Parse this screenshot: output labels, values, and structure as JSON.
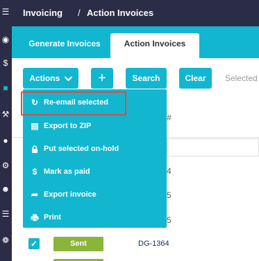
{
  "sidebar": {
    "icons": [
      "menu-icon",
      "globe-icon",
      "dollar-icon",
      "folder-icon",
      "wrench-icon",
      "bicycle-icon",
      "gear-icon",
      "user-icon",
      "list-icon",
      "cog-icon"
    ]
  },
  "header": {
    "breadcrumb": [
      "Invoicing",
      "Action Invoices"
    ],
    "separator": "/"
  },
  "tabs": [
    {
      "label": "Generate Invoices",
      "active": false
    },
    {
      "label": "Action Invoices",
      "active": true
    }
  ],
  "toolbar": {
    "actions_label": "Actions",
    "plus_label": "+",
    "search_label": "Search",
    "clear_label": "Clear",
    "selected_text": "Selected"
  },
  "actions_menu": {
    "items": [
      {
        "label": "Re-email selected",
        "icon": "refresh-icon",
        "highlighted": true
      },
      {
        "label": "Export to ZIP",
        "icon": "zip-file-icon"
      },
      {
        "label": "Put selected on-hold",
        "icon": "lock-icon"
      },
      {
        "label": "Mark as paid",
        "icon": "dollar-icon"
      },
      {
        "label": "Export invoice",
        "icon": "share-icon"
      },
      {
        "label": "Print",
        "icon": "printer-icon"
      }
    ]
  },
  "table": {
    "header_fragment": "#",
    "partial_cells": [
      "4",
      "5",
      "5"
    ],
    "rows": [
      {
        "checked": true,
        "status": "Sent",
        "invoice": "DG-1364"
      }
    ]
  },
  "colors": {
    "accent": "#12b6cf",
    "nav": "#2b2c45",
    "status_sent": "#8ab43a",
    "highlight": "#e04a3f"
  }
}
